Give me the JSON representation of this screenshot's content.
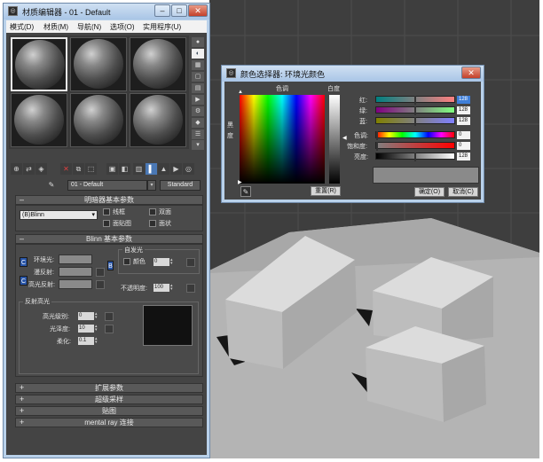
{
  "material_editor": {
    "title": "材质编辑器 - 01 - Default",
    "window_buttons": [
      "–",
      "□",
      "✕"
    ],
    "menu": [
      "模式(D)",
      "材质(M)",
      "导航(N)",
      "选项(O)",
      "实用程序(U)"
    ],
    "slot_count": 6,
    "material_name": "01 - Default",
    "material_type": "Standard",
    "rollouts": {
      "shader_basic": "明暗器基本参数",
      "shader_type": "(B)Blinn",
      "shader_options": [
        "线框",
        "双面",
        "面贴图",
        "面状"
      ],
      "blinn_basic": "Blinn 基本参数",
      "self_illum_group": "自发光",
      "self_illum_color": "颜色",
      "self_illum_value": "0",
      "ambient": "环境光:",
      "diffuse": "漫反射:",
      "specular": "高光反射:",
      "opacity_label": "不透明度:",
      "opacity_value": "100",
      "spec_highlights": "反射高光",
      "spec_level_label": "高光级别:",
      "spec_level": "0",
      "glossiness_label": "光泽度:",
      "glossiness": "10",
      "soften_label": "柔化:",
      "soften": "0.1",
      "extended": "扩展参数",
      "supersampling": "超级采样",
      "maps": "贴图",
      "mental_ray": "mental ray 连接",
      "lock_letter": "C",
      "swatch_lock_letter": "B",
      "expand_sign": "+",
      "collapse_sign": "–"
    }
  },
  "color_picker": {
    "title": "颜色选择器: 环境光颜色",
    "hue_label": "色调",
    "whiteness_label": "白度",
    "blackness_label": "黑\n度",
    "channels": [
      {
        "label": "红:",
        "value": "128"
      },
      {
        "label": "绿:",
        "value": "128"
      },
      {
        "label": "蓝:",
        "value": "128"
      },
      {
        "label": "色调:",
        "value": "0"
      },
      {
        "label": "饱和度:",
        "value": "0"
      },
      {
        "label": "亮度:",
        "value": "128"
      }
    ],
    "reset_button": "重置(R)",
    "ok_button": "确定(O)",
    "cancel_button": "取消(C)",
    "preview_color": "#808080"
  },
  "colors": {
    "viewport_bg": "#3e3e3e",
    "accent_blue": "#3f7fd9",
    "title_close": "#c3402a"
  }
}
